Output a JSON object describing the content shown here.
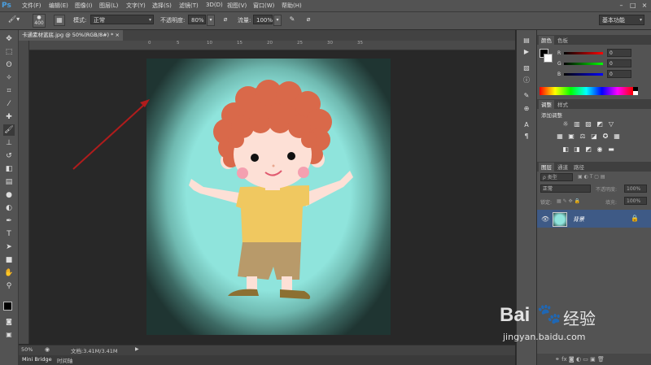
{
  "app": {
    "logo": "Ps"
  },
  "menu": [
    "文件(F)",
    "编辑(E)",
    "图像(I)",
    "图层(L)",
    "文字(Y)",
    "选择(S)",
    "滤镜(T)",
    "3D(D)",
    "视图(V)",
    "窗口(W)",
    "帮助(H)"
  ],
  "options": {
    "brush_size": "400",
    "mode_label": "模式:",
    "mode_value": "正常",
    "opacity_label": "不透明度:",
    "opacity_value": "80%",
    "flow_label": "流量:",
    "flow_value": "100%",
    "workspace": "基本功能"
  },
  "document": {
    "tab_title": "卡通素材蓝底.jpg @ 50%(RGB/8#) *",
    "close": "×",
    "zoom": "50%",
    "doc_info": "文档:3.41M/3.41M",
    "ruler_labels": [
      "0",
      "5",
      "10",
      "15",
      "20",
      "25",
      "30",
      "35"
    ]
  },
  "bottom_tabs": [
    "Mini Bridge",
    "时间轴"
  ],
  "panels": {
    "color_tabs": [
      "颜色",
      "色板"
    ],
    "color_channels": [
      {
        "label": "R",
        "value": "0"
      },
      {
        "label": "G",
        "value": "0"
      },
      {
        "label": "B",
        "value": "0"
      }
    ],
    "adjust_tabs": [
      "调整",
      "样式"
    ],
    "adjust_title": "添加调整",
    "layers_tabs": [
      "图层",
      "通道",
      "路径"
    ],
    "filter_kind": "ρ 类型",
    "blend_mode": "正常",
    "opacity_label": "不透明度:",
    "opacity_value": "100%",
    "lock_label": "锁定:",
    "fill_label": "填充:",
    "fill_value": "100%",
    "layer_name": "背景"
  },
  "watermark": {
    "brand": "Bai",
    "brand2": "经验",
    "url": "jingyan.baidu.com"
  },
  "colors": {
    "accent": "#3e5a86",
    "canvas_bg": "#8fe4dc",
    "arrow": "#b01c1c",
    "hair": "#d9694a",
    "shirt": "#f0c860",
    "shorts": "#b89a6a"
  }
}
